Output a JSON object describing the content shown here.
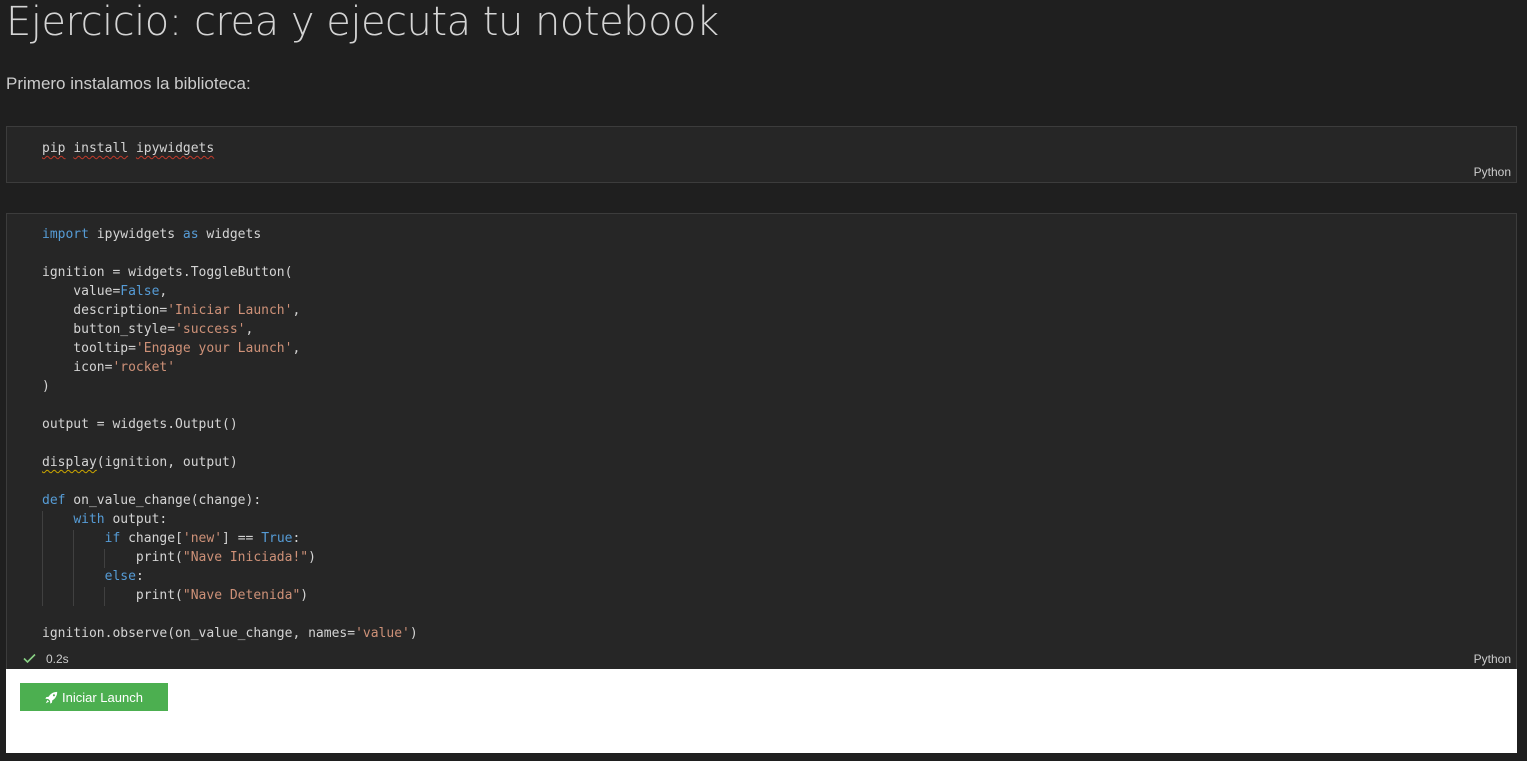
{
  "markdown": {
    "heading": "Ejercicio: crea y ejecuta tu notebook",
    "paragraph": "Primero instalamos la biblioteca:"
  },
  "cell1": {
    "language": "Python",
    "code": {
      "pip": "pip",
      "install": "install",
      "pkg": "ipywidgets"
    }
  },
  "cell2": {
    "language": "Python",
    "exec_time": "0.2s",
    "status_icon": "check-icon",
    "code": {
      "l1_import": "import",
      "l1_mod": " ipywidgets ",
      "l1_as": "as",
      "l1_alias": " widgets",
      "l3": "ignition = widgets.ToggleButton(",
      "l4_a": "    value=",
      "l4_b": "False",
      "l4_c": ",",
      "l5_a": "    description=",
      "l5_b": "'Iniciar Launch'",
      "l5_c": ",",
      "l6_a": "    button_style=",
      "l6_b": "'success'",
      "l6_c": ",",
      "l7_a": "    tooltip=",
      "l7_b": "'Engage your Launch'",
      "l7_c": ",",
      "l8_a": "    icon=",
      "l8_b": "'rocket'",
      "l9": ")",
      "l11": "output = widgets.Output()",
      "l13_a": "display",
      "l13_b": "(ignition, output)",
      "l15_a": "def",
      "l15_b": " on_value_change(change):",
      "l16_a": "    ",
      "l16_b": "with",
      "l16_c": " output:",
      "l17_a": "        ",
      "l17_b": "if",
      "l17_c": " change[",
      "l17_d": "'new'",
      "l17_e": "] == ",
      "l17_f": "True",
      "l17_g": ":",
      "l18_a": "            print(",
      "l18_b": "\"Nave Iniciada!\"",
      "l18_c": ")",
      "l19_a": "        ",
      "l19_b": "else",
      "l19_c": ":",
      "l20_a": "            print(",
      "l20_b": "\"Nave Detenida\"",
      "l20_c": ")",
      "l22_a": "ignition.observe(on_value_change, names=",
      "l22_b": "'value'",
      "l22_c": ")"
    }
  },
  "widget": {
    "button_label": "Iniciar Launch",
    "button_icon": "rocket-icon",
    "button_color": "#4caf50"
  },
  "colors": {
    "keyword": "#569cd6",
    "string": "#ce9178",
    "background": "#1f1f1f",
    "cell_background": "#262626"
  }
}
